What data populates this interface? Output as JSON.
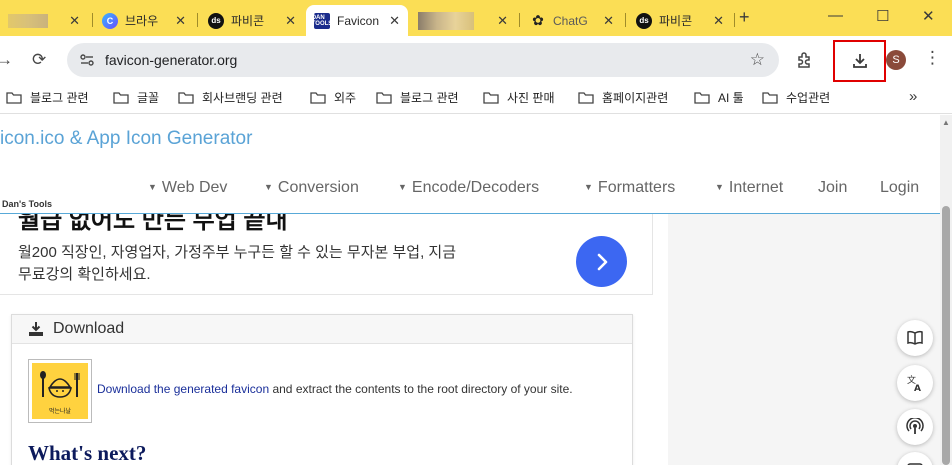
{
  "browser": {
    "tabs": [
      {
        "title": "브라우",
        "favicon": "c-circle-icon"
      },
      {
        "title": "파비콘",
        "favicon": "ds-icon"
      },
      {
        "title": "Favicon",
        "favicon": "dans-tools-icon",
        "active": true
      },
      {
        "title": "ChatG",
        "favicon": "openai-icon"
      },
      {
        "title": "파비콘",
        "favicon": "ds-icon"
      }
    ],
    "new_tab_symbol": "+",
    "window_controls": {
      "minimize": "—",
      "maximize": "☐",
      "close": "✕"
    },
    "url": "favicon-generator.org",
    "profile_initial": "S",
    "bookmarks": [
      "블로그 관련",
      "글꼴",
      "회사브랜딩 관련",
      "외주",
      "블로그 관련",
      "사진 판매",
      "홈페이지관련",
      "AI 툴",
      "수업관련"
    ],
    "bookmarks_more": "»"
  },
  "site": {
    "title": "icon.ico & App Icon Generator",
    "logo_text": "Dan's Tools",
    "nav": [
      {
        "label": "Web Dev",
        "dropdown": true
      },
      {
        "label": "Conversion",
        "dropdown": true
      },
      {
        "label": "Encode/Decoders",
        "dropdown": true
      },
      {
        "label": "Formatters",
        "dropdown": true
      },
      {
        "label": "Internet",
        "dropdown": true
      },
      {
        "label": "Join",
        "dropdown": false
      },
      {
        "label": "Login",
        "dropdown": false
      }
    ]
  },
  "ad": {
    "headline": "월급 없어도 만든 부업 끝내",
    "line1": "월200 직장인, 자영업자, 가정주부 누구든 할 수 있는 무자본 부업, 지금",
    "line2": "무료강의 확인하세요.",
    "button_color": "#3c67f2"
  },
  "download_card": {
    "heading": "Download",
    "thumb_text": "먹는나날",
    "link_text": "Download the generated favicon",
    "rest_text": " and extract the contents to the root directory of your site.",
    "next_heading": "What's next?"
  },
  "colors": {
    "tabstrip": "#fbde55",
    "highlight_box": "#e00000",
    "site_title": "#5aa3d6",
    "header_line": "#58a9d8"
  }
}
